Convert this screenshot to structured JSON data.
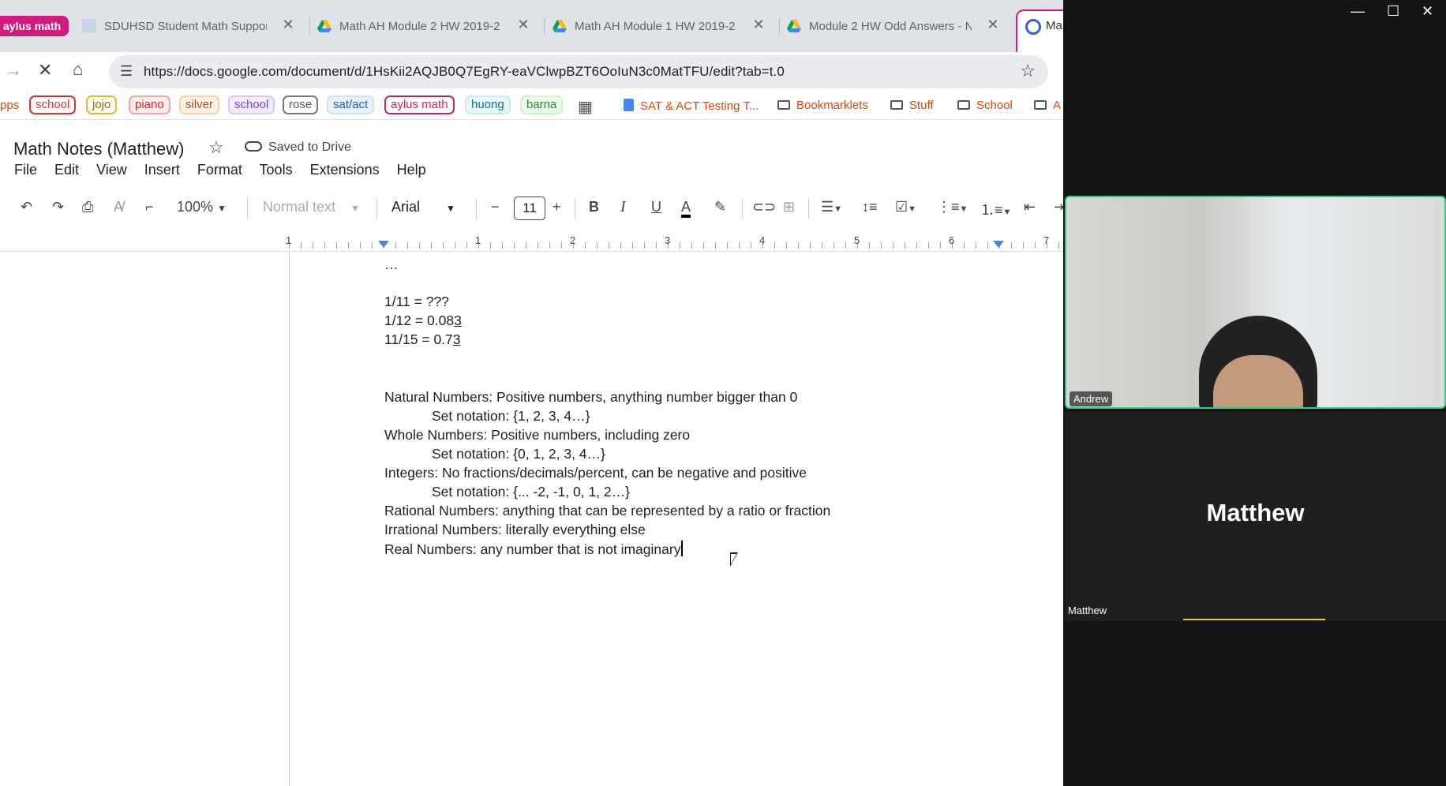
{
  "browser": {
    "tabs": [
      {
        "label": "aylus math"
      },
      {
        "label": "SDUHSD Student Math Suppor"
      },
      {
        "label": "Math AH Module 2 HW 2019-2"
      },
      {
        "label": "Math AH Module 1 HW 2019-2"
      },
      {
        "label": "Module 2 HW Odd Answers - N"
      },
      {
        "label": "Ma"
      }
    ],
    "url": "https://docs.google.com/document/d/1HsKii2AQJB0Q7EgRY-eaVClwpBZT6OoIuN3c0MatTFU/edit?tab=t.0",
    "bookmarks": {
      "apps": "pps",
      "chips": [
        "school",
        "jojo",
        "piano",
        "silver",
        "school",
        "rose",
        "sat/act",
        "aylus math",
        "huong",
        "barna"
      ],
      "sat_act_doc": "SAT & ACT Testing T...",
      "folders": [
        "Bookmarklets",
        "Stuff",
        "School",
        "A"
      ]
    }
  },
  "docs": {
    "title": "Math Notes (Matthew)",
    "save_status": "Saved to Drive",
    "menus": [
      "File",
      "Edit",
      "View",
      "Insert",
      "Format",
      "Tools",
      "Extensions",
      "Help"
    ],
    "toolbar": {
      "zoom": "100%",
      "style": "Normal text",
      "font": "Arial",
      "font_size": "11"
    },
    "ruler": [
      "1",
      "1",
      "2",
      "3",
      "4",
      "5",
      "6",
      "7"
    ],
    "lines": {
      "ellipsis": "…",
      "l1": "1/11 = ???",
      "l2a": "1/12 = 0.08",
      "l2b": "3",
      "l3a": "11/15 = 0.7",
      "l3b": "3",
      "natural": "Natural Numbers: Positive numbers, anything number bigger than 0",
      "natural_set": "Set notation: {1, 2, 3, 4…}",
      "whole": "Whole Numbers: Positive numbers, including zero",
      "whole_set": "Set notation: {0, 1, 2, 3, 4…}",
      "integers": "Integers: No fractions/decimals/percent, can be negative and positive",
      "integers_set": "Set notation: {... -2, -1, 0, 1, 2…}",
      "rational": "Rational Numbers: anything that can be represented by a ratio or fraction",
      "irrational": "Irrational Numbers: literally everything else",
      "real": "Real Numbers: any number that is not imaginary"
    }
  },
  "call": {
    "participant1_label": "Andrew",
    "participant2_name": "Matthew",
    "participant2_label": "Matthew"
  },
  "colors": {
    "accent_pink": "#d01c7e",
    "speaker_green": "#2fcc83"
  }
}
